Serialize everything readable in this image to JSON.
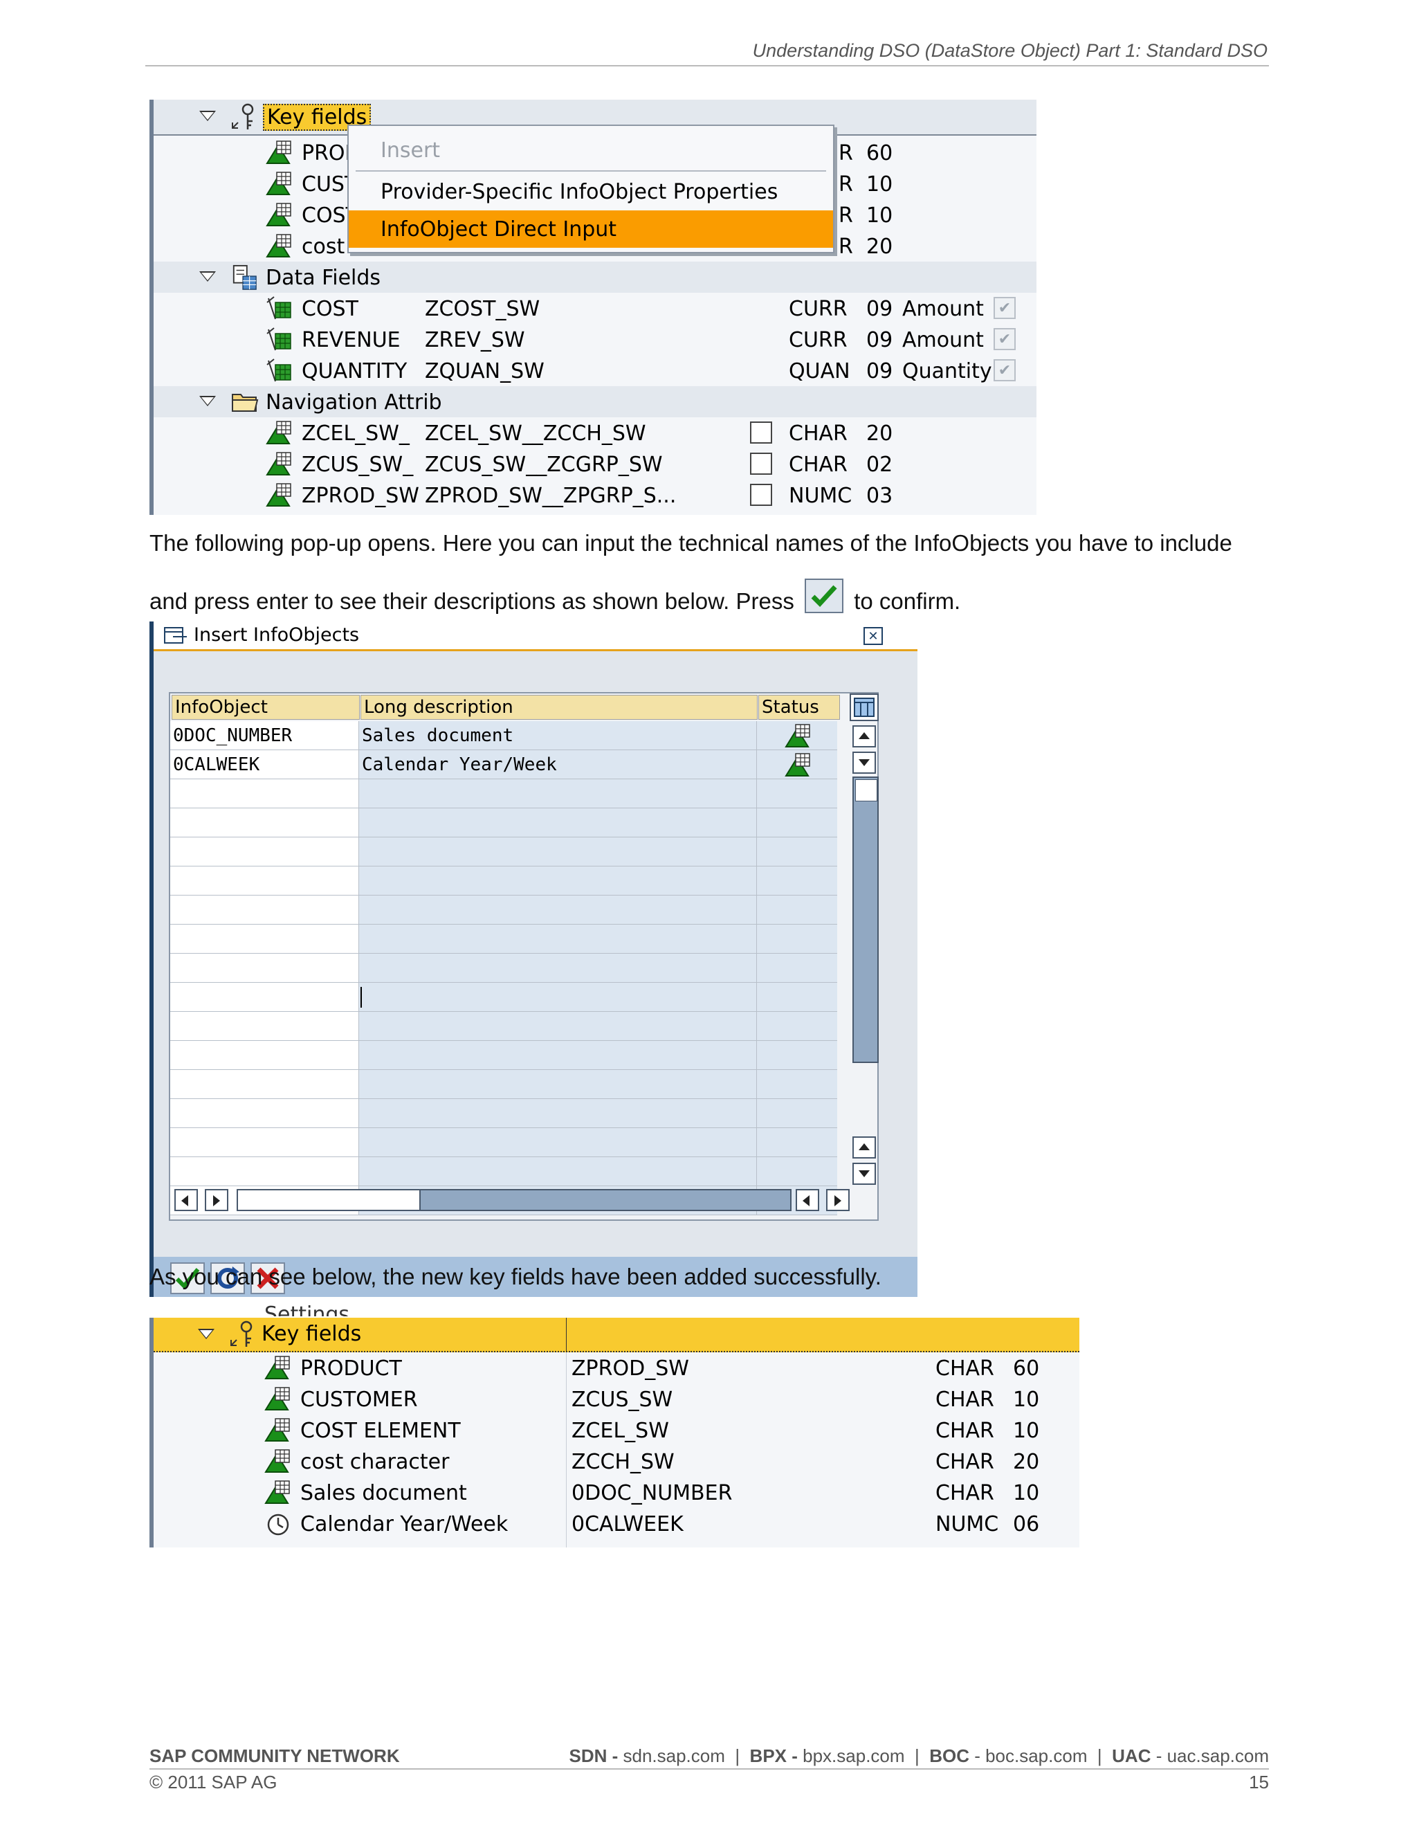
{
  "header": {
    "doc_title": "Understanding DSO (DataStore Object) Part 1: Standard DSO"
  },
  "shot1": {
    "key_fields_label": "Key fields",
    "key_rows": [
      {
        "name": "PROD",
        "len": "60"
      },
      {
        "name": "CUST",
        "len": "10"
      },
      {
        "name": "COST",
        "len": "10"
      },
      {
        "name": "cost c",
        "len": "20"
      }
    ],
    "type_fragment": "R",
    "context_menu": {
      "items": [
        "Insert",
        "Provider-Specific InfoObject Properties",
        "InfoObject Direct Input"
      ],
      "selected": "InfoObject Direct Input"
    },
    "data_fields_label": "Data Fields",
    "data_rows": [
      {
        "name": "COST",
        "tech": "ZCOST_SW",
        "type": "CURR",
        "len": "09",
        "unit": "Amount"
      },
      {
        "name": "REVENUE",
        "tech": "ZREV_SW",
        "type": "CURR",
        "len": "09",
        "unit": "Amount"
      },
      {
        "name": "QUANTITY",
        "tech": "ZQUAN_SW",
        "type": "QUAN",
        "len": "09",
        "unit": "Quantity"
      }
    ],
    "nav_label": "Navigation Attrib",
    "nav_rows": [
      {
        "name": "ZCEL_SW_",
        "tech": "ZCEL_SW__ZCCH_SW",
        "type": "CHAR",
        "len": "20"
      },
      {
        "name": "ZCUS_SW_",
        "tech": "ZCUS_SW__ZCGRP_SW",
        "type": "CHAR",
        "len": "02"
      },
      {
        "name": "ZPROD_SW",
        "tech": "ZPROD_SW__ZPGRP_S...",
        "type": "NUMC",
        "len": "03"
      }
    ]
  },
  "para1": "The following pop-up opens. Here you can input the technical names of the InfoObjects you have to include",
  "para2_before": "and press enter to see their descriptions as shown below. Press",
  "para2_after": "to confirm.",
  "dialog": {
    "title": "Insert InfoObjects",
    "columns": [
      "InfoObject",
      "Long description",
      "Status"
    ],
    "rows": [
      {
        "infoobject": "0DOC_NUMBER",
        "description": "Sales document"
      },
      {
        "infoobject": "0CALWEEK",
        "description": "Calendar Year/Week"
      }
    ]
  },
  "para3": "As you can see below, the new key fields have been added successfully.",
  "shot2": {
    "partial_label": "Settings",
    "key_fields_label": "Key fields",
    "rows": [
      {
        "name": "PRODUCT",
        "tech": "ZPROD_SW",
        "type": "CHAR",
        "len": "60"
      },
      {
        "name": "CUSTOMER",
        "tech": "ZCUS_SW",
        "type": "CHAR",
        "len": "10"
      },
      {
        "name": "COST ELEMENT",
        "tech": "ZCEL_SW",
        "type": "CHAR",
        "len": "10"
      },
      {
        "name": "cost character",
        "tech": "ZCCH_SW",
        "type": "CHAR",
        "len": "20"
      },
      {
        "name": "Sales document",
        "tech": "0DOC_NUMBER",
        "type": "CHAR",
        "len": "10"
      },
      {
        "name": "Calendar Year/Week",
        "tech": "0CALWEEK",
        "type": "NUMC",
        "len": "06"
      }
    ]
  },
  "footer": {
    "network": "SAP COMMUNITY NETWORK",
    "sdn_label": "SDN - ",
    "sdn_url": "sdn.sap.com",
    "bpx_label": "BPX - ",
    "bpx_url": "bpx.sap.com",
    "boc_label": "BOC",
    "boc_url": " - boc.sap.com",
    "uac_label": "UAC",
    "uac_url": " - uac.sap.com",
    "copyright": "© 2011 SAP AG",
    "page_number": "15"
  },
  "colors": {
    "highlight_orange": "#fa9c00",
    "keyfield_yellow": "#f8ca2f",
    "header_yellow": "#f3e2a6",
    "cell_blue": "#dce6f1",
    "dialog_border": "#1f4166"
  }
}
